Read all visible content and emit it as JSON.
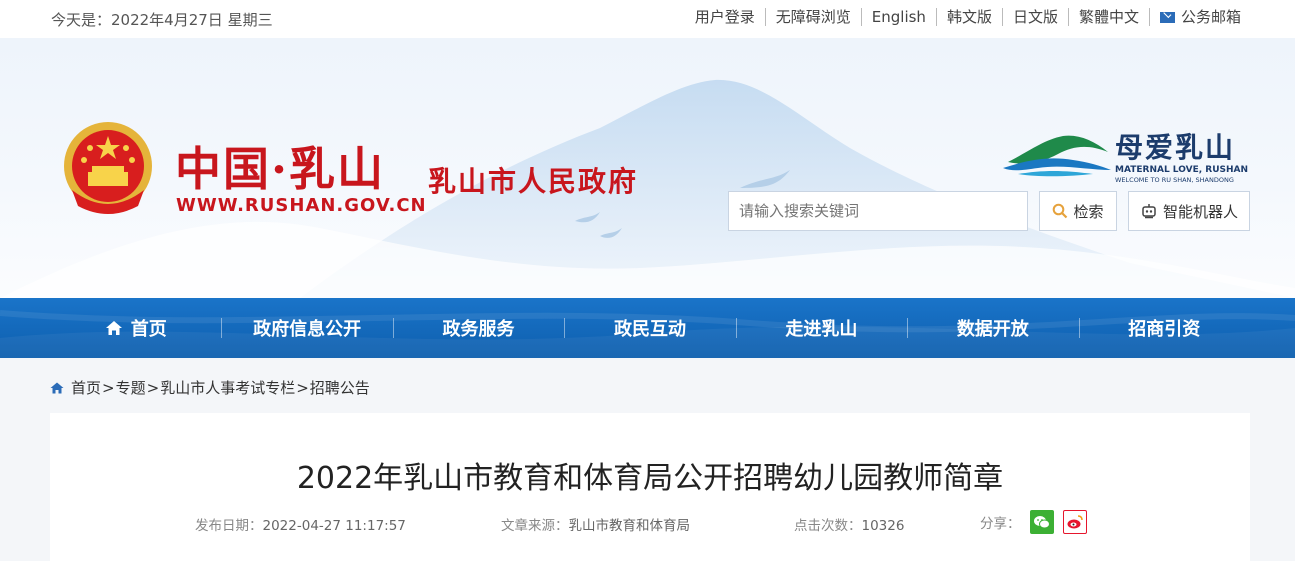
{
  "topbar": {
    "date": "今天是：2022年4月27日 星期三",
    "links": [
      "用户登录",
      "无障碍浏览",
      "English",
      "韩文版",
      "日文版",
      "繁體中文"
    ],
    "mail": "公务邮箱"
  },
  "header": {
    "title_cn": "中国·乳山",
    "url": "WWW.RUSHAN.GOV.CN",
    "gov_name": "乳山市人民政府",
    "slogan_cn": "母爱乳山",
    "slogan_en": "MATERNAL LOVE, RUSHAN",
    "slogan_en2": "WELCOME TO RU SHAN, SHANDONG",
    "search_placeholder": "请输入搜索关键词",
    "search_button": "检索",
    "robot_button": "智能机器人"
  },
  "nav": {
    "items": [
      "首页",
      "政府信息公开",
      "政务服务",
      "政民互动",
      "走进乳山",
      "数据开放",
      "招商引资"
    ]
  },
  "breadcrumb": {
    "items": [
      "首页",
      "专题",
      "乳山市人事考试专栏",
      "招聘公告"
    ],
    "separator": ">"
  },
  "article": {
    "title": "2022年乳山市教育和体育局公开招聘幼儿园教师简章",
    "date_label": "发布日期：",
    "date": "2022-04-27 11:17:57",
    "source_label": "文章来源：",
    "source": "乳山市教育和体育局",
    "views_label": "点击次数：",
    "views": "10326",
    "share_label": "分享："
  },
  "colors": {
    "brand_red": "#c8161d",
    "nav_blue": "#1467b9",
    "wechat_green": "#3cb034",
    "weibo_red": "#e6162d"
  }
}
